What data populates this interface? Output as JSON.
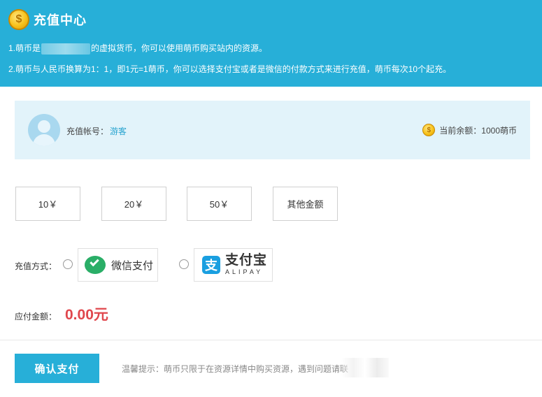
{
  "header": {
    "title": "充值中心",
    "line1_prefix": "1.萌币是",
    "line1_suffix": "的虚拟货币，你可以使用萌币购买站内的资源。",
    "line2": "2.萌币与人民币换算为1：1，即1元=1萌币，你可以选择支付宝或者是微信的付款方式来进行充值，萌币每次10个起充。",
    "coin_symbol": "$"
  },
  "account": {
    "label": "充值帐号：",
    "username": "游客",
    "balance_text": "当前余额：1000萌币"
  },
  "amounts": [
    "10￥",
    "20￥",
    "50￥",
    "其他金额"
  ],
  "payment": {
    "label": "充值方式：",
    "wechat": "微信支付",
    "alipay_cn": "支付宝",
    "alipay_en": "ALIPAY",
    "alipay_icon_char": "支"
  },
  "due": {
    "label": "应付金额：",
    "amount": "0.00元"
  },
  "footer": {
    "confirm": "确认支付",
    "tip": "温馨提示：萌币只限于在资源详情中购买资源，遇到问题请联"
  },
  "colors": {
    "accent": "#27afd8",
    "price": "#e0474d",
    "wechat": "#2aae67",
    "alipay": "#1a9fe0"
  }
}
